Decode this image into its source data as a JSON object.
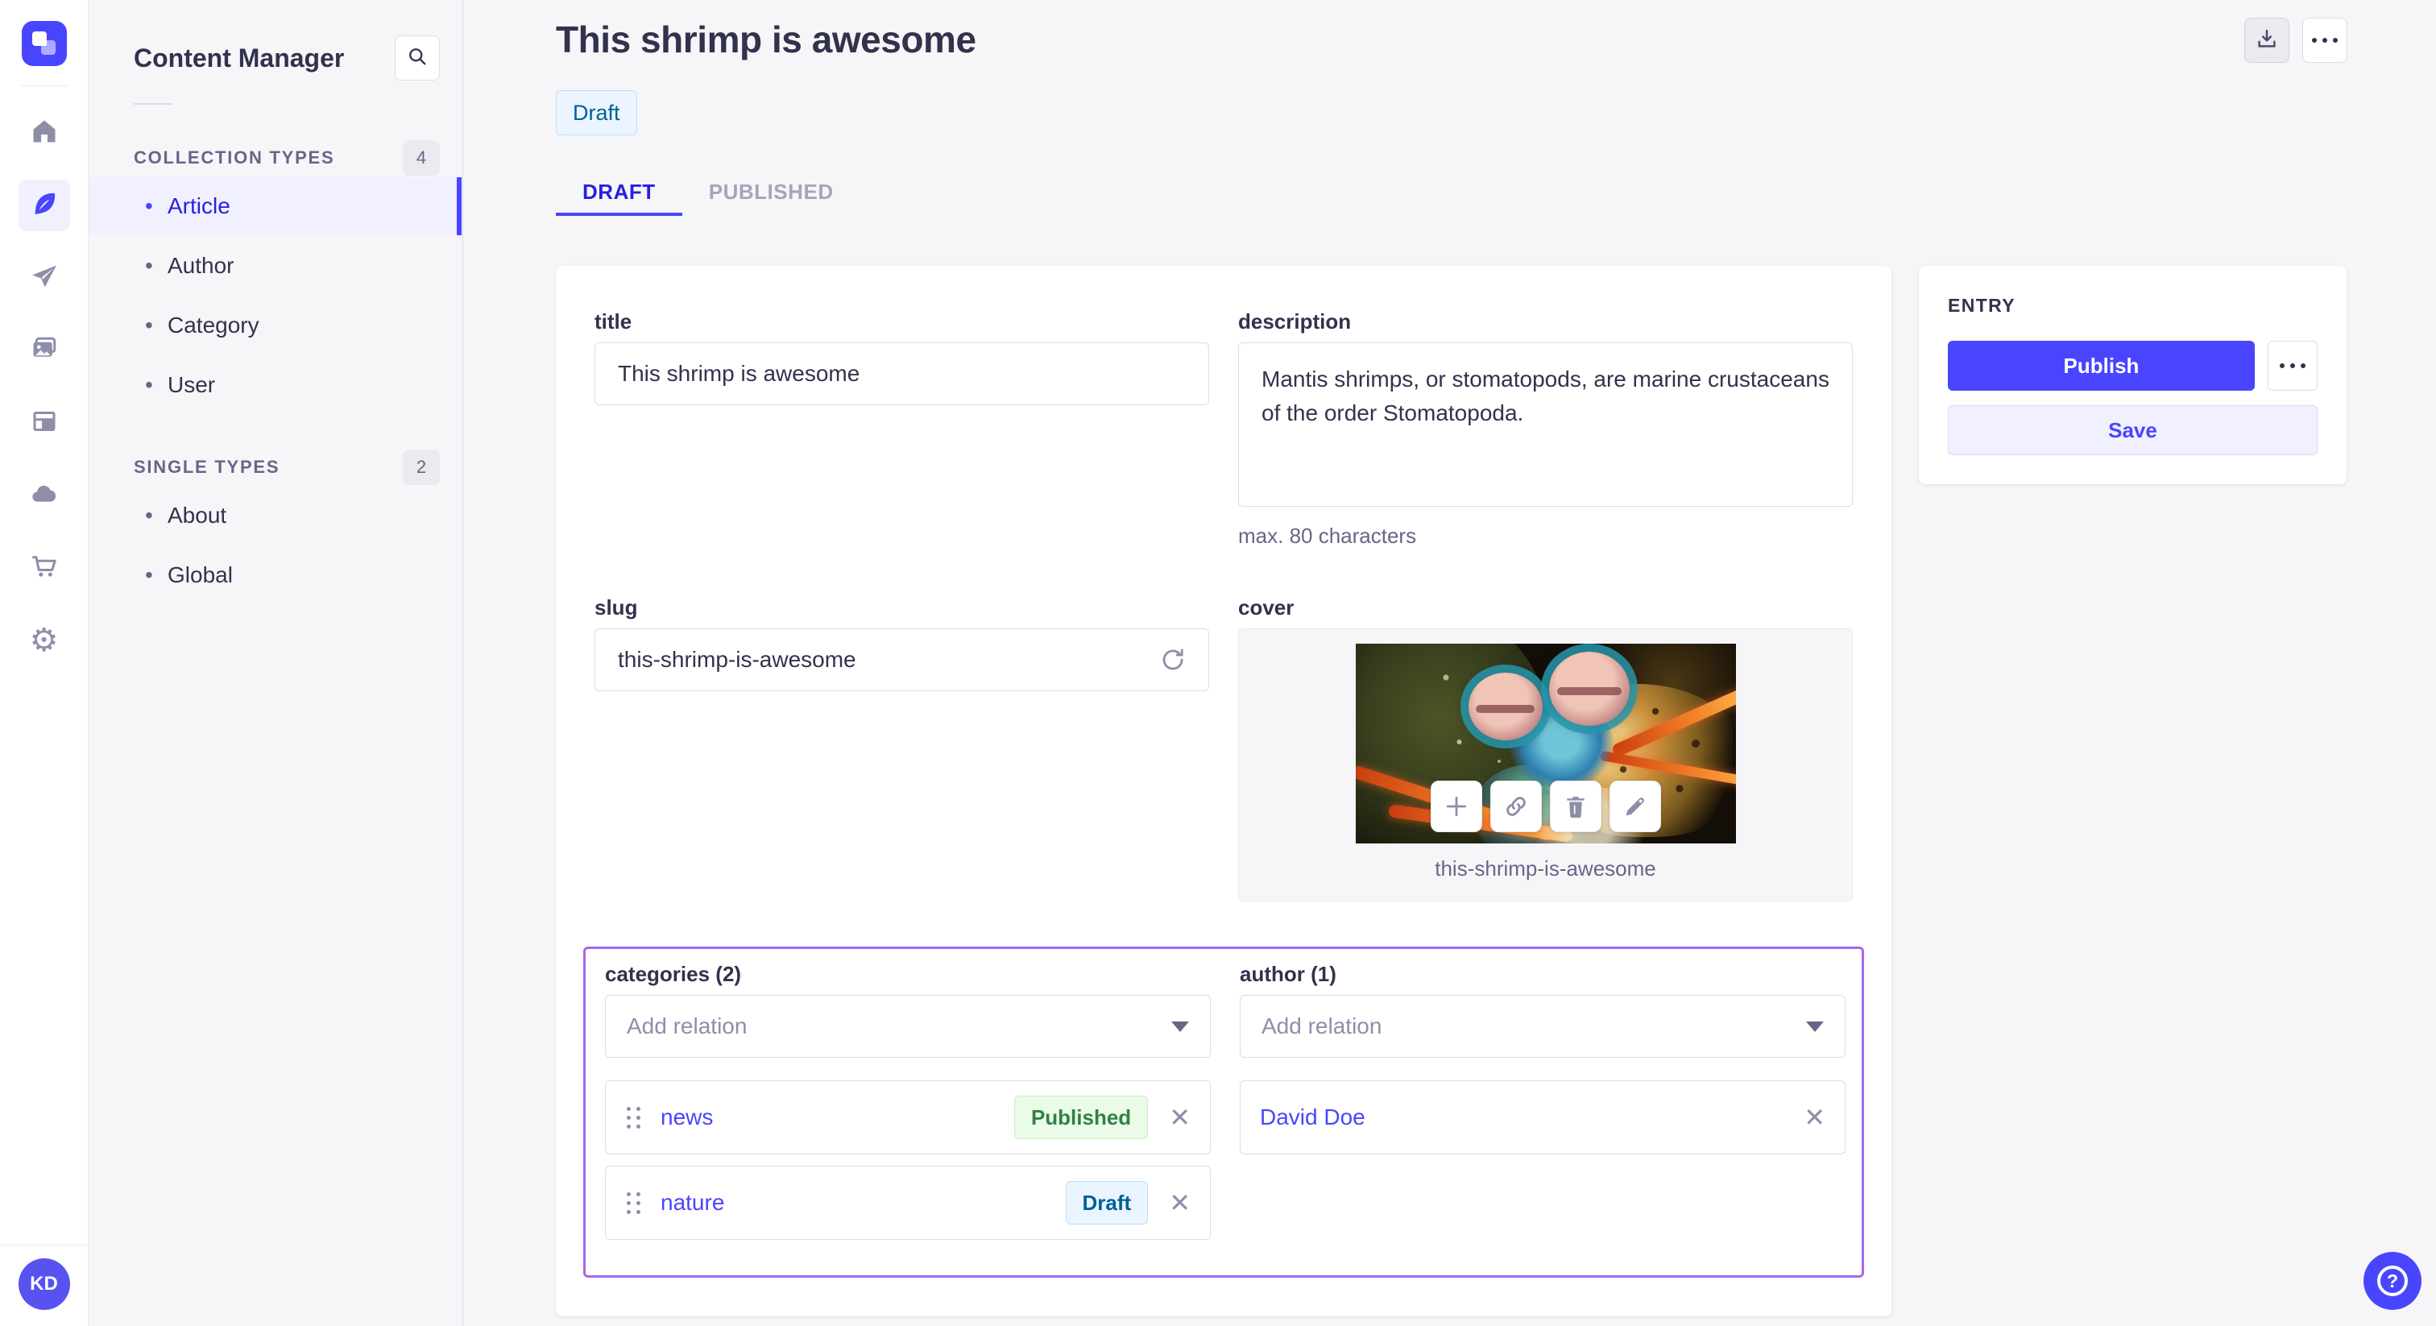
{
  "colors": {
    "accent": "#4945ff",
    "active_nav_text": "#271fe0",
    "relations_outline": "#a866f2",
    "draft_badge_text": "#006096",
    "published_badge_text": "#328048",
    "subnav_bg": "#f6f6f9",
    "avatar_bg": "#5752f0"
  },
  "rail": {
    "icons": [
      "strapi-logo",
      "home",
      "content-feather",
      "releases-paper-plane",
      "media-library",
      "content-type-builder",
      "cloud",
      "marketplace-cart",
      "settings-gear"
    ],
    "active_icon": "content-feather",
    "user_initials": "KD"
  },
  "subnav": {
    "title": "Content Manager",
    "search_icon": "search-icon",
    "collection_types": {
      "label": "COLLECTION TYPES",
      "count": "4",
      "items": [
        {
          "label": "Article",
          "active": true
        },
        {
          "label": "Author"
        },
        {
          "label": "Category"
        },
        {
          "label": "User"
        }
      ]
    },
    "single_types": {
      "label": "SINGLE TYPES",
      "count": "2",
      "items": [
        {
          "label": "About"
        },
        {
          "label": "Global"
        }
      ]
    }
  },
  "header": {
    "title": "This shrimp is awesome",
    "status_badge": "Draft",
    "actions": [
      "download-icon",
      "more-options"
    ]
  },
  "tabs": {
    "draft": "DRAFT",
    "published": "PUBLISHED",
    "active": "DRAFT"
  },
  "form": {
    "title": {
      "label": "title",
      "value": "This shrimp is awesome"
    },
    "description": {
      "label": "description",
      "value": "Mantis shrimps, or stomatopods, are marine crustaceans of the order Stomatopoda.",
      "hint": "max. 80 characters"
    },
    "slug": {
      "label": "slug",
      "value": "this-shrimp-is-awesome",
      "refresh_icon": "regenerate-icon"
    },
    "cover": {
      "label": "cover",
      "caption": "this-shrimp-is-awesome",
      "action_icons": [
        "add-icon",
        "link-icon",
        "trash-icon",
        "pencil-icon"
      ]
    },
    "categories": {
      "label": "categories (2)",
      "placeholder": "Add relation",
      "items": [
        {
          "name": "news",
          "status": "Published"
        },
        {
          "name": "nature",
          "status": "Draft"
        }
      ]
    },
    "author": {
      "label": "author (1)",
      "placeholder": "Add relation",
      "items": [
        {
          "name": "David Doe"
        }
      ]
    }
  },
  "entry_panel": {
    "title": "ENTRY",
    "publish_label": "Publish",
    "save_label": "Save",
    "more_icon": "more-options"
  },
  "help": {
    "icon": "question-mark-icon"
  },
  "close_glyph": "✕",
  "bullet_glyph": "•"
}
